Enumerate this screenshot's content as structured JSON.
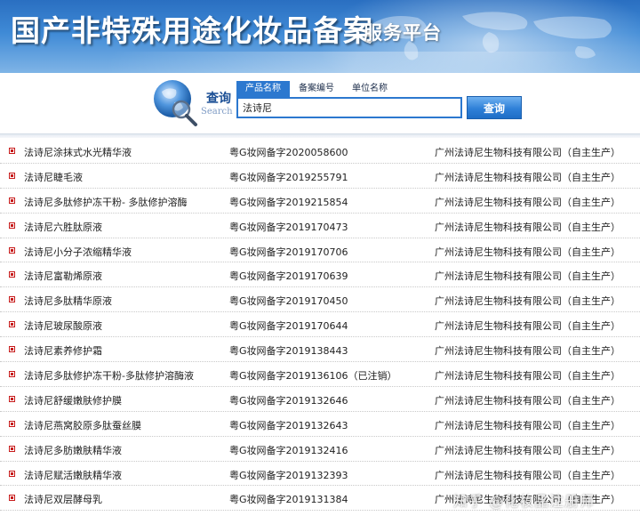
{
  "header": {
    "title": "国产非特殊用途化妆品备案",
    "subtitle": "服务平台"
  },
  "search": {
    "label_cn": "查询",
    "label_en": "Search",
    "tabs": [
      "产品名称",
      "备案编号",
      "单位名称"
    ],
    "active_tab": "产品名称",
    "input_value": "法诗尼",
    "button_label": "查询"
  },
  "results": [
    {
      "name": "法诗尼涂抹式水光精华液",
      "code": "粤G妆网备字2020058600",
      "company": "广州法诗尼生物科技有限公司（自主生产）"
    },
    {
      "name": "法诗尼睫毛液",
      "code": "粤G妆网备字2019255791",
      "company": "广州法诗尼生物科技有限公司（自主生产）"
    },
    {
      "name": "法诗尼多肽修护冻干粉- 多肽修护溶酶",
      "code": "粤G妆网备字2019215854",
      "company": "广州法诗尼生物科技有限公司（自主生产）"
    },
    {
      "name": "法诗尼六胜肽原液",
      "code": "粤G妆网备字2019170473",
      "company": "广州法诗尼生物科技有限公司（自主生产）"
    },
    {
      "name": "法诗尼小分子浓缩精华液",
      "code": "粤G妆网备字2019170706",
      "company": "广州法诗尼生物科技有限公司（自主生产）"
    },
    {
      "name": "法诗尼富勒烯原液",
      "code": "粤G妆网备字2019170639",
      "company": "广州法诗尼生物科技有限公司（自主生产）"
    },
    {
      "name": "法诗尼多肽精华原液",
      "code": "粤G妆网备字2019170450",
      "company": "广州法诗尼生物科技有限公司（自主生产）"
    },
    {
      "name": "法诗尼玻尿酸原液",
      "code": "粤G妆网备字2019170644",
      "company": "广州法诗尼生物科技有限公司（自主生产）"
    },
    {
      "name": "法诗尼素养修护霜",
      "code": "粤G妆网备字2019138443",
      "company": "广州法诗尼生物科技有限公司（自主生产）"
    },
    {
      "name": "法诗尼多肽修护冻干粉-多肽修护溶酶液",
      "code": "粤G妆网备字2019136106（已注销）",
      "company": "广州法诗尼生物科技有限公司（自主生产）"
    },
    {
      "name": "法诗尼舒缓嫩肤修护膜",
      "code": "粤G妆网备字2019132646",
      "company": "广州法诗尼生物科技有限公司（自主生产）"
    },
    {
      "name": "法诗尼燕窝胶原多肽蚕丝膜",
      "code": "粤G妆网备字2019132643",
      "company": "广州法诗尼生物科技有限公司（自主生产）"
    },
    {
      "name": "法诗尼多肪嫩肤精华液",
      "code": "粤G妆网备字2019132416",
      "company": "广州法诗尼生物科技有限公司（自主生产）"
    },
    {
      "name": "法诗尼赋活嫩肤精华液",
      "code": "粤G妆网备字2019132393",
      "company": "广州法诗尼生物科技有限公司（自主生产）"
    },
    {
      "name": "法诗尼双层酵母乳",
      "code": "粤G妆网备字2019131384",
      "company": "广州法诗尼生物科技有限公司（自主生产）"
    }
  ],
  "watermark": "知乎 @化妆品注册师",
  "colors": {
    "banner": "#3f8ad6",
    "accent": "#2c78cf",
    "bullet": "#c71a1a"
  }
}
